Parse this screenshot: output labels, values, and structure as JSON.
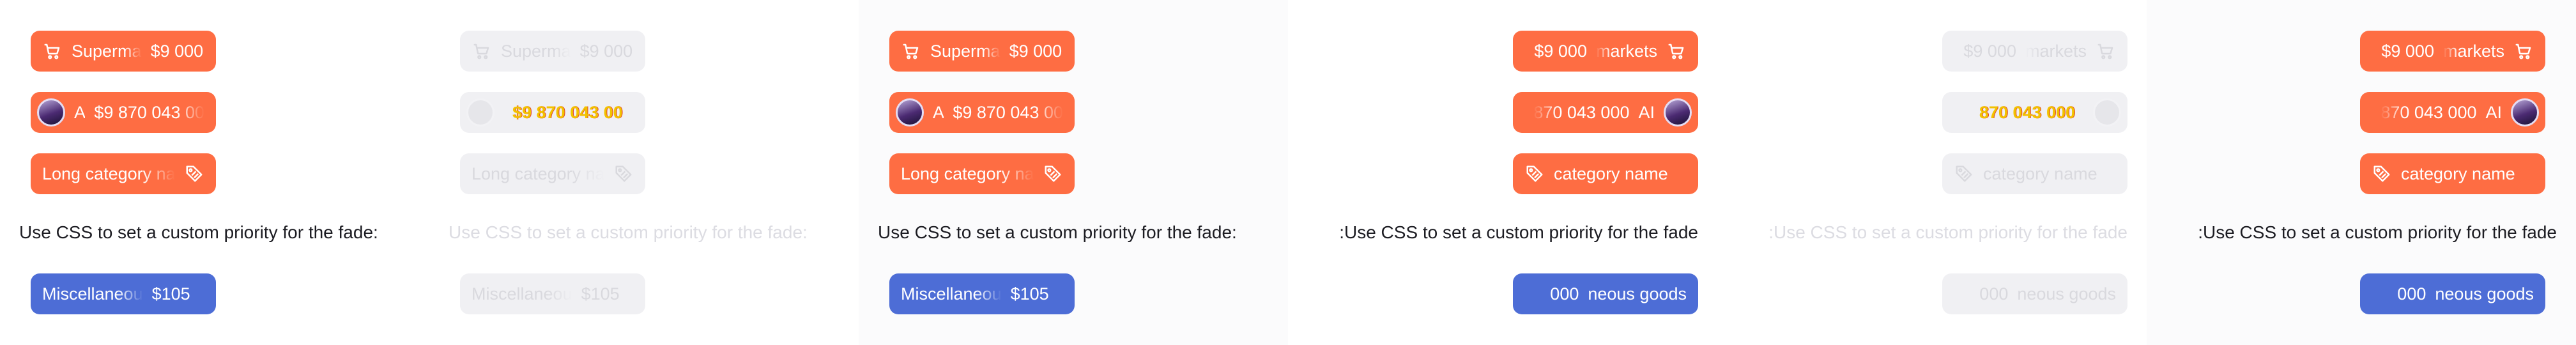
{
  "colors": {
    "orange": "#fe6d43",
    "blue": "#4d6dd6",
    "dim_chip": "#f0f0f3",
    "caption": "#1c1c22"
  },
  "icons": {
    "cart": "cart-icon",
    "tag": "tag-icon",
    "avatar": "avatar"
  },
  "panels": [
    {
      "chip1": {
        "label": "Superma",
        "amount": "$9 000"
      },
      "chip2": {
        "label": "AI",
        "amount": "$9 870 043 00"
      },
      "chip3": {
        "label": "Long category na"
      },
      "caption": "Use CSS to set a custom priority for the fade:",
      "chip4": {
        "label": "Miscellaneou",
        "amount": "$105"
      }
    },
    {
      "chip1": {
        "label": "Superma",
        "amount": "$9 000"
      },
      "chip2": {
        "label": "",
        "amount": "$9 870 043 00"
      },
      "chip3": {
        "label": "Long category na"
      },
      "caption": "Use CSS to set a custom priority for the fade:",
      "chip4": {
        "label": "Miscellaneou",
        "amount": "$105"
      }
    },
    {
      "chip1": {
        "label": "Superma",
        "amount": "$9 000"
      },
      "chip2": {
        "label": "AI",
        "amount": "$9 870 043 00"
      },
      "chip3": {
        "label": "Long category na"
      },
      "caption": "Use CSS to set a custom priority for the fade:",
      "chip4": {
        "label": "Miscellaneou",
        "amount": "$105"
      }
    },
    {
      "chip1": {
        "label": "markets",
        "amount": "$9 000"
      },
      "chip2": {
        "label": "AI",
        "amount": "870 043 000"
      },
      "chip3": {
        "label": "category name"
      },
      "caption": ":Use CSS to set a custom priority for the fade",
      "chip4": {
        "label": "neous goods",
        "amount": "000"
      }
    },
    {
      "chip1": {
        "label": "markets",
        "amount": "$9 000"
      },
      "chip2": {
        "label": "",
        "amount": "870 043 000"
      },
      "chip3": {
        "label": "category name"
      },
      "caption": ":Use CSS to set a custom priority for the fade",
      "chip4": {
        "label": "neous goods",
        "amount": "000"
      }
    },
    {
      "chip1": {
        "label": "markets",
        "amount": "$9 000"
      },
      "chip2": {
        "label": "AI",
        "amount": "870 043 000"
      },
      "chip3": {
        "label": "category name"
      },
      "caption": ":Use CSS to set a custom priority for the fade",
      "chip4": {
        "label": "neous goods",
        "amount": "000"
      }
    }
  ]
}
